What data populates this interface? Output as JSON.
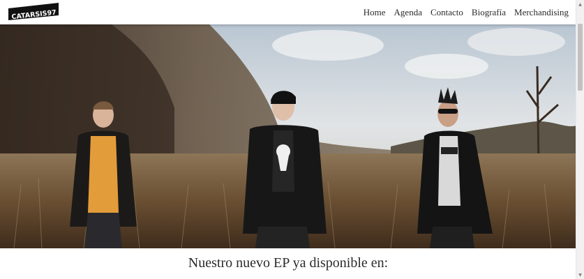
{
  "logo": {
    "text": "CATARSIS97"
  },
  "nav": {
    "items": [
      "Home",
      "Agenda",
      "Contacto",
      "Biografía",
      "Merchandising"
    ]
  },
  "hero": {
    "description_icon": "band-photo"
  },
  "main": {
    "ep_heading": "Nuestro nuevo EP ya disponible en:"
  },
  "colors": {
    "accent": "#2a2a2a",
    "background": "#ffffff"
  }
}
